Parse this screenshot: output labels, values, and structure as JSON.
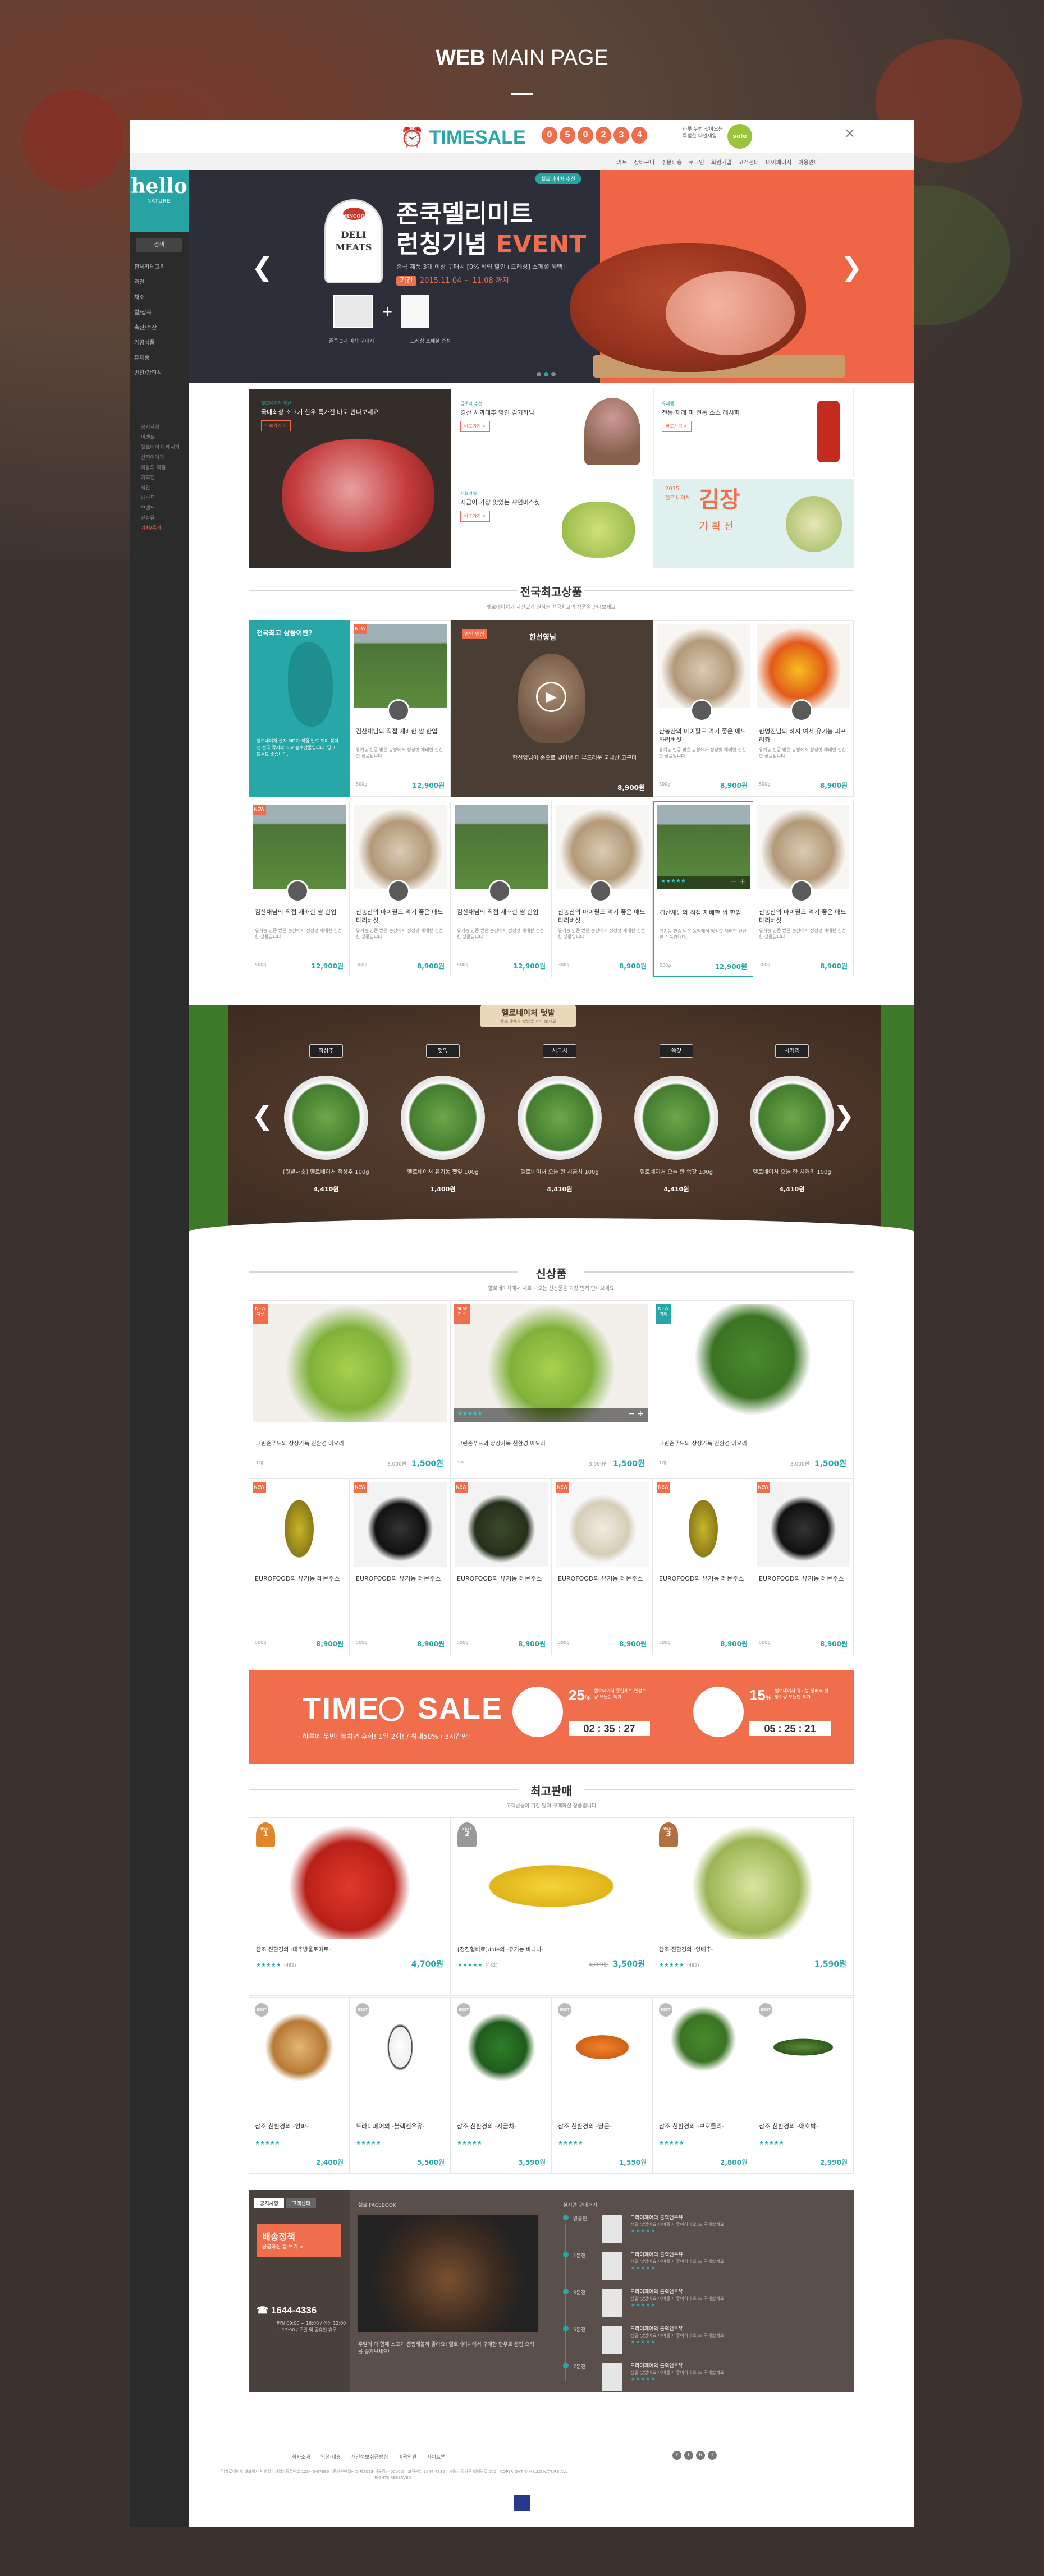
{
  "page": {
    "heading_bold": "WEB",
    "heading_rest": " MAIN PAGE"
  },
  "timesale_bar": {
    "logo": "TIMESALE",
    "digits": [
      "0",
      "5",
      "0",
      "2",
      "3",
      "4"
    ],
    "note": "하루 두번 찾아오는 특별한 타임세일",
    "icon_label": "sale",
    "close": "×"
  },
  "util": {
    "links": [
      "카트",
      "장바구니",
      "주문배송",
      "로그인",
      "회원가입",
      "고객센터",
      "마이페이지",
      "이용안내"
    ]
  },
  "sidebar": {
    "logo": "hello",
    "logo_sub": "NATURE",
    "search": "검색",
    "menu": [
      "전체카테고리",
      "과일",
      "채소",
      "쌀/잡곡",
      "축산/수산",
      "가공식품",
      "유제품",
      "반찬/간편식"
    ],
    "sub": [
      "공지사항",
      "이벤트",
      "헬로네이처 레시피",
      "산지이야기",
      "이달의 제철",
      "기획전",
      "식단",
      "베스트",
      "브랜드",
      "신상품",
      "기획/특가"
    ]
  },
  "hero": {
    "tag": "헬로네이처 추천",
    "badge_brand": "JOHNCOOK",
    "badge": [
      "DELI",
      "MEATS"
    ],
    "title1": "존쿡델리미트",
    "title2a": "런칭기념 ",
    "title2b": "EVENT",
    "desc": "존쿡 제품 3개 이상 구매시 [0% 적립 할인+드레싱] 스페셜 혜택!",
    "date_label": "기간",
    "date": "2015.11.04 ~ 11.08 까지",
    "cap1": "존쿡 3개 이상 구매시",
    "cap2": "드레싱 스페셜 증정",
    "left": "❮",
    "right": "❯"
  },
  "promo": {
    "big": {
      "small": "헬로네이처 축산",
      "title": "국내최상 소고기 한우 특가전 바로 만나보세요",
      "more": "바로가기 >"
    },
    "c1": {
      "small": "금주의 추천",
      "title": "경산 사과대추 명인 김기하님",
      "more": "바로가기 >"
    },
    "c2": {
      "small": "유제품",
      "title": "전통 재래 마 전통 소스 레시피",
      "more": "바로가기 >"
    },
    "c3": {
      "small": "제철과일",
      "title": "지금이 가장 맛있는 샤인머스켓",
      "more": "바로가기 >"
    },
    "kimjang": {
      "year": "2015",
      "title": "김장",
      "sub": "기 획 전",
      "brand": "헬로 네이처"
    }
  },
  "best_section": {
    "title": "전국최고상품",
    "sub": "헬로네이처가 자신있게 권하는 전국최고의 상품을 만나보세요"
  },
  "infocard": {
    "q": "전국최고 상품이란?",
    "desc": "헬로네이처 산지 MD가 직접 발로 뛰며 찾아낸 전국 각지의 최고 농수산물입니다. 믿고 드셔도 좋습니다."
  },
  "video": {
    "tag": "명인 영상",
    "title": "한선영님",
    "desc": "한선영님이 손으로 빚어낸 더 부드러운 국내산 고구마",
    "price": "8,900원",
    "play": "▶"
  },
  "row1": [
    {
      "name": "김산채님의 직접 재배한 쌈 한입",
      "price": "12,900원",
      "wt": "500g",
      "img": "imgfield",
      "new": "NEW"
    },
    {
      "name": "산농산의 마이필드 먹기 좋은 애느타리버섯",
      "price": "8,900원",
      "wt": "300g",
      "img": "imgmush",
      "new": ""
    },
    {
      "name": "한명진님의 하지 여서 유기농 파프리카",
      "price": "8,900원",
      "wt": "500g",
      "img": "imgpeppers",
      "new": ""
    }
  ],
  "row2": [
    {
      "name": "김산채님의 직접 재배한 쌈 한입",
      "price": "12,900원",
      "wt": "500g",
      "img": "imgfield",
      "new": "NEW"
    },
    {
      "name": "산농산의 마이필드 먹기 좋은 애느타리버섯",
      "price": "8,900원",
      "wt": "300g",
      "img": "imgmush",
      "new": ""
    },
    {
      "name": "김산채님의 직접 재배한 쌈 한입",
      "price": "12,900원",
      "wt": "500g",
      "img": "imgfield",
      "new": ""
    },
    {
      "name": "산농산의 마이필드 먹기 좋은 애느타리버섯",
      "price": "8,900원",
      "wt": "300g",
      "img": "imgmush",
      "new": ""
    },
    {
      "name": "김산채님의 직접 재배한 쌈 한입",
      "price": "12,900원",
      "wt": "500g",
      "img": "imgfield",
      "new": ""
    },
    {
      "name": "산농산의 마이필드 먹기 좋은 애느타리버섯",
      "price": "8,900원",
      "wt": "300g",
      "img": "imgmush",
      "new": ""
    }
  ],
  "card_desc": "유기농 인증 받은 농장에서 정성껏 재배한 신선한 상품입니다.",
  "tools": {
    "stars": "★★★★★",
    "pm": "−  +"
  },
  "soil": {
    "title": "헬로네이처 텃밭",
    "sub": "헬로네이처 텃밭을 만나보세요",
    "left": "❮",
    "right": "❯",
    "items": [
      {
        "sign": "적상추",
        "name": "[텃밭채소] 헬로네이처 적상추 100g",
        "price": "4,410원"
      },
      {
        "sign": "깻잎",
        "name": "헬로네이처 유기농 깻잎 100g",
        "price": "1,400원"
      },
      {
        "sign": "시금치",
        "name": "헬로네이처 오늘 한 시금치 100g",
        "price": "4,410원"
      },
      {
        "sign": "쑥갓",
        "name": "헬로네이처 오늘 한 쑥갓 100g",
        "price": "4,410원"
      },
      {
        "sign": "치커리",
        "name": "헬로네이처 오늘 한 치커리 100g",
        "price": "4,410원"
      }
    ]
  },
  "new_section": {
    "title": "신상품",
    "sub": "헬로네이처에서 새로 나오는 신상품을 가장 먼저 만나보세요"
  },
  "newbig": [
    {
      "name": "그린존푸드의 상상가득 친환경 아오리",
      "price": "1,500원",
      "old": "3,000원",
      "wt": "1개",
      "img": "fruit",
      "new": "NEW 하루"
    },
    {
      "name": "그린존푸드의 상상가득 친환경 아오리",
      "price": "1,500원",
      "old": "3,000원",
      "wt": "1개",
      "img": "fruit",
      "new": "NEW 하루"
    },
    {
      "name": "그린존푸드의 상상가득 친환경 아오리",
      "price": "1,500원",
      "old": "3,000원",
      "wt": "1개",
      "img": "broc",
      "new": "NEW 기획"
    }
  ],
  "newsmall": [
    {
      "name": "EUROFOOD의 유기농 레몬주스",
      "price": "8,900원",
      "img": "bottle"
    },
    {
      "name": "EUROFOOD의 유기농 레몬주스",
      "price": "8,900원",
      "img": "seaweed"
    },
    {
      "name": "EUROFOOD의 유기농 레몬주스",
      "price": "8,900원",
      "img": "squash"
    },
    {
      "name": "EUROFOOD의 유기농 레몬주스",
      "price": "8,900원",
      "img": "garlic"
    },
    {
      "name": "EUROFOOD의 유기농 레몬주스",
      "price": "8,900원",
      "img": "bottle"
    },
    {
      "name": "EUROFOOD의 유기농 레몬주스",
      "price": "8,900원",
      "img": "seaweed"
    }
  ],
  "timesale": {
    "title1": "TIME",
    "title2": "SALE",
    "sub": "하루에 두번! 놓치면 후회! 1일 2회! / 최대50% / 3시간만!",
    "items": [
      {
        "num": "25",
        "unit": "%",
        "lbl": "헬로네이처 종합세트 한정수량 오늘만 특가",
        "time": "02 : 35 : 27"
      },
      {
        "num": "15",
        "unit": "%",
        "lbl": "헬로네이처 유기농 양배추 한정수량 오늘만 특가",
        "time": "05 : 25 : 21"
      }
    ]
  },
  "bestsale": {
    "title": "최고판매",
    "sub": "고객님들이 가장 많이 구매하신 상품입니다"
  },
  "bestbig": [
    {
      "rank": "1",
      "name": "참조 친환경의 -대추방울토마토-",
      "price": "4,700원",
      "reviews": "(482)",
      "img": "tomato"
    },
    {
      "rank": "2",
      "name": "[정진협비료]dole의 -유기농 바나나-",
      "price": "3,500원",
      "old": "4,200원",
      "reviews": "(482)",
      "img": "banana"
    },
    {
      "rank": "3",
      "name": "참조 친환경의 -양배추-",
      "price": "1,590원",
      "reviews": "(482)",
      "img": "cabb"
    }
  ],
  "bestsmall": [
    {
      "name": "참조 친환경의 -양파-",
      "price": "2,400원",
      "img": "onion"
    },
    {
      "name": "드라이페어의 -블랙앤우유-",
      "price": "5,500원",
      "img": "milk"
    },
    {
      "name": "참조 친환경의 -시금치-",
      "price": "3,590원",
      "img": "spinach"
    },
    {
      "name": "참조 친환경의 -당근-",
      "price": "1,550원",
      "img": "carrot"
    },
    {
      "name": "참조 친환경의 -브로콜리-",
      "price": "2,800원",
      "img": "broc"
    },
    {
      "name": "참조 친환경의 -애호박-",
      "price": "2,990원",
      "img": "zuc"
    }
  ],
  "info": {
    "tabs": [
      "공지사항",
      "고객센터"
    ],
    "deliv_title": "배송정책",
    "deliv_sub": "궁금하신 점 보기 >",
    "phone": "1644-4336",
    "hours": "평일 09:00 ~ 18:00 / 점심 12:00 ~ 13:00 / 주말 및 공휴일 휴무",
    "fb_title": "헬로 FACEBOOK",
    "fb_text": "주말에 다 함께 소고기 캠핑해볼까 좋아요! 헬로네이처에서 구매한 한우로 캠핑 요리를 즐겨보세요!",
    "rt_title": "실시간 구매후기",
    "rows": [
      {
        "tt": "방금전",
        "m": "드라이페어의 블랙앤우유",
        "s": "정말 맛있어요 아이들이 좋아하네요 또 구매할게요"
      },
      {
        "tt": "1분전",
        "m": "드라이페어의 블랙앤우유",
        "s": "정말 맛있어요 아이들이 좋아하네요 또 구매할게요"
      },
      {
        "tt": "3분전",
        "m": "드라이페어의 블랙앤우유",
        "s": "정말 맛있어요 아이들이 좋아하네요 또 구매할게요"
      },
      {
        "tt": "5분전",
        "m": "드라이페어의 블랙앤우유",
        "s": "정말 맛있어요 아이들이 좋아하네요 또 구매할게요"
      },
      {
        "tt": "7분전",
        "m": "드라이페어의 블랙앤우유",
        "s": "정말 맛있어요 아이들이 좋아하네요 또 구매할게요"
      }
    ]
  },
  "footer": {
    "links": [
      "회사소개",
      "입점·제휴",
      "개인정보취급방침",
      "이용약관",
      "사이트맵"
    ],
    "addr": "(주)헬로네이처 대표이사 박병열 | 사업자등록번호 123-45-67890 | 통신판매업신고 제2015-서울강남-0000호 | 고객센터 1644-4336 | 서울시 강남구 테헤란로 000 | COPYRIGHT © HELLO NATURE ALL RIGHTS RESERVED",
    "social": [
      "f",
      "t",
      "b",
      "i"
    ]
  }
}
